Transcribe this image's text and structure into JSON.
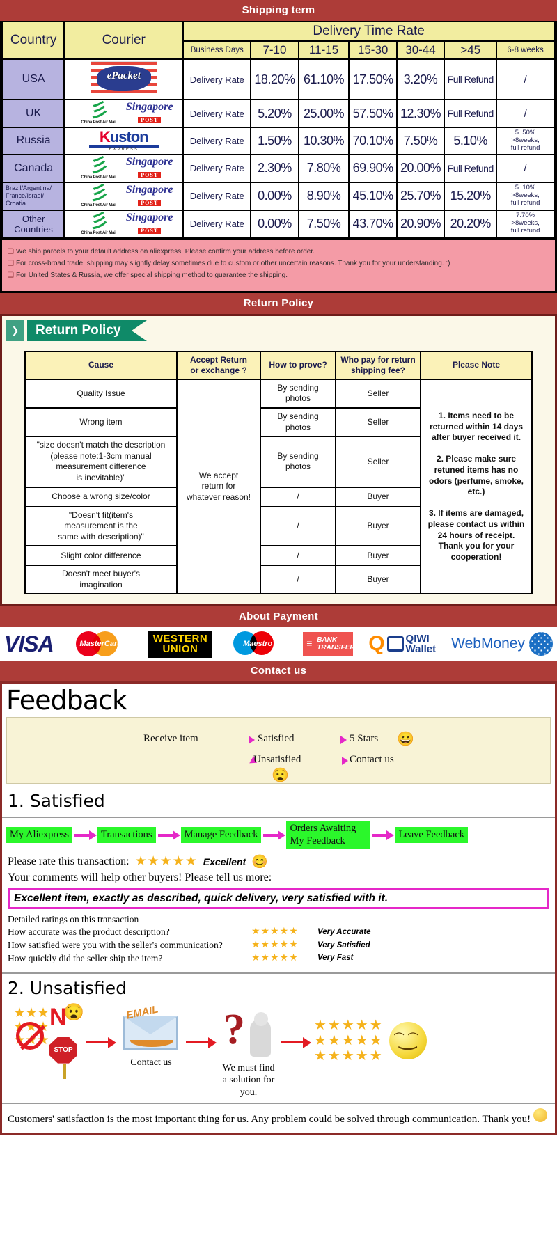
{
  "banners": {
    "shipping": "Shipping term",
    "return": "Return Policy",
    "payment": "About Payment",
    "contact": "Contact us"
  },
  "shipping": {
    "headers": {
      "country": "Country",
      "courier": "Courier",
      "delivery_time_rate": "Delivery Time Rate",
      "business_days": "Business Days",
      "ranges": [
        "7-10",
        "11-15",
        "15-30",
        "30-44",
        "&gt;45",
        "6-8 weeks"
      ]
    },
    "rate_label": "Delivery Rate",
    "rows": [
      {
        "country": "USA",
        "couriers": [
          "epacket"
        ],
        "values": [
          "18.20%",
          "61.10%",
          "17.50%",
          "3.20%",
          "Full Refund",
          "/"
        ]
      },
      {
        "country": "UK",
        "couriers": [
          "china-post-air-mail",
          "singapore-post"
        ],
        "values": [
          "5.20%",
          "25.00%",
          "57.50%",
          "12.30%",
          "Full Refund",
          "/"
        ]
      },
      {
        "country": "Russia",
        "couriers": [
          "kuston-express"
        ],
        "values": [
          "1.50%",
          "10.30%",
          "70.10%",
          "7.50%",
          "5.10%",
          "5. 50%\n>8weeks,\nfull refund"
        ]
      },
      {
        "country": "Canada",
        "couriers": [
          "china-post-air-mail",
          "singapore-post"
        ],
        "values": [
          "2.30%",
          "7.80%",
          "69.90%",
          "20.00%",
          "Full Refund",
          "/"
        ]
      },
      {
        "country": "Brazil/Argentina/France/Israel/Croatia",
        "couriers": [
          "china-post-air-mail",
          "singapore-post"
        ],
        "values": [
          "0.00%",
          "8.90%",
          "45.10%",
          "25.70%",
          "15.20%",
          "5. 10%\n>8weeks,\nfull refund"
        ]
      },
      {
        "country": "Other Countries",
        "couriers": [
          "china-post-air-mail",
          "singapore-post"
        ],
        "values": [
          "0.00%",
          "7.50%",
          "43.70%",
          "20.90%",
          "20.20%",
          "7.70%\n>8weeks,\nfull refund"
        ]
      }
    ],
    "notes": [
      "We ship parcels to your default address on aliexpress. Please confirm your address before order.",
      "For cross-broad trade, shipping may slightly delay sometimes due to custom or other uncertain reasons. Thank you for your understanding. :)",
      "For United States & Russia, we offer special shipping method to guarantee the shipping."
    ]
  },
  "return_policy": {
    "ribbon_label": "Return Policy",
    "headers": [
      "Cause",
      "Accept Return or exchange ?",
      "How to prove?",
      "Who pay for return shipping fee?",
      "Please Note"
    ],
    "accept_cell": "We accept return for whatever reason!",
    "rows": [
      {
        "cause": "Quality Issue",
        "prove": "By sending photos",
        "payer": "Seller"
      },
      {
        "cause": "Wrong item",
        "prove": "By sending photos",
        "payer": "Seller"
      },
      {
        "cause": "\"size doesn't match the description (please note:1-3cm manual measurement difference is inevitable)\"",
        "prove": "By sending photos",
        "payer": "Seller"
      },
      {
        "cause": "Choose a wrong size/color",
        "prove": "/",
        "payer": "Buyer"
      },
      {
        "cause": "\"Doesn't fit(item's measurement is the same with description)\"",
        "prove": "/",
        "payer": "Buyer"
      },
      {
        "cause": "Slight color difference",
        "prove": "/",
        "payer": "Buyer"
      },
      {
        "cause": "Doesn't meet buyer's imagination",
        "prove": "/",
        "payer": "Buyer"
      }
    ],
    "note": "1. Items need to be returned within 14 days after buyer received it.\n\n2. Please make sure retuned items has no odors (perfume, smoke, etc.)\n\n3. If items are damaged, please contact us within 24 hours of receipt.\nThank you for your cooperation!"
  },
  "payment": {
    "methods": [
      {
        "name": "visa",
        "label": "VISA"
      },
      {
        "name": "mastercard",
        "label": "MasterCard"
      },
      {
        "name": "western-union",
        "line1": "WESTERN",
        "line2": "UNION"
      },
      {
        "name": "maestro",
        "label": "Maestro"
      },
      {
        "name": "bank-transfer",
        "line1": "BANK",
        "line2": "TRANSFER"
      },
      {
        "name": "qiwi-wallet",
        "line1": "QIWI",
        "line2": "Wallet"
      },
      {
        "name": "webmoney",
        "label": "WebMoney"
      }
    ]
  },
  "feedback": {
    "title": "Feedback",
    "flow": {
      "receive": "Receive item",
      "satisfied": "Satisfied",
      "five_stars": "5 Stars",
      "unsatisfied": "Unsatisfied",
      "contact_us": "Contact us"
    },
    "satisfied_heading": "1. Satisfied",
    "chain": [
      "My Aliexpress",
      "Transactions",
      "Manage Feedback",
      "Orders Awaiting My Feedback",
      "Leave Feedback"
    ],
    "rate_prompt": "Please rate this transaction:",
    "stars": "★★★★★",
    "rating_word": "Excellent",
    "comment_prompt": "Your comments will help other buyers! Please tell us more:",
    "comment_text": "Excellent item, exactly as described, quick delivery, very satisfied with it.",
    "detailed_title": "Detailed ratings on this transaction",
    "detailed": [
      {
        "question": "How accurate was the product description?",
        "stars": "★★★★★",
        "value": "Very Accurate"
      },
      {
        "question": "How satisfied were you with the seller's communication?",
        "stars": "★★★★★",
        "value": "Very Satisfied"
      },
      {
        "question": "How quickly did the seller ship the item?",
        "stars": "★★★★★",
        "value": "Very Fast"
      }
    ],
    "unsatisfied_heading": "2. Unsatisfied",
    "unsat_flow": {
      "no_label": "N",
      "stop_label": "STOP",
      "email_label": "EMAIL",
      "contact_caption": "Contact us",
      "solution_caption": "We must find a solution for you.",
      "stars_block": "★★★★★"
    },
    "closing": "Customers' satisfaction is the most important thing for us. Any problem could be solved through communication. Thank you!"
  },
  "colors": {
    "banner_red": "#ad3c38",
    "table_header_yellow": "#f2eda0",
    "country_purple": "#b7b3e0",
    "note_pink": "#f49ba6",
    "chip_green": "#2bf72b",
    "arrow_pink": "#e528c8",
    "star_gold": "#f5b21b"
  }
}
